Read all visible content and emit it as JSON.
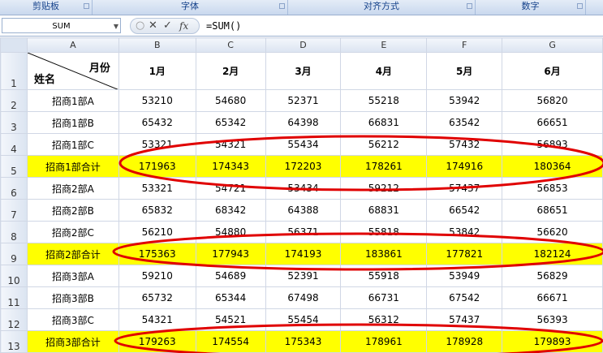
{
  "ribbon": {
    "groups": [
      "剪贴板",
      "字体",
      "对齐方式",
      "数字"
    ]
  },
  "formula_bar": {
    "name_box": "SUM",
    "fx_label": "fx",
    "formula": "=SUM()"
  },
  "sheet": {
    "columns": [
      "A",
      "B",
      "C",
      "D",
      "E",
      "F",
      "G"
    ],
    "header_month": "月份",
    "header_name": "姓名",
    "months": [
      "1月",
      "2月",
      "3月",
      "4月",
      "5月",
      "6月"
    ],
    "rows": [
      {
        "n": "2",
        "name": "招商1部A",
        "values": [
          "53210",
          "54680",
          "52371",
          "55218",
          "53942",
          "56820"
        ],
        "total": false
      },
      {
        "n": "3",
        "name": "招商1部B",
        "values": [
          "65432",
          "65342",
          "64398",
          "66831",
          "63542",
          "66651"
        ],
        "total": false
      },
      {
        "n": "4",
        "name": "招商1部C",
        "values": [
          "53321",
          "54321",
          "55434",
          "56212",
          "57432",
          "56893"
        ],
        "total": false
      },
      {
        "n": "5",
        "name": "招商1部合计",
        "values": [
          "171963",
          "174343",
          "172203",
          "178261",
          "174916",
          "180364"
        ],
        "total": true
      },
      {
        "n": "6",
        "name": "招商2部A",
        "values": [
          "53321",
          "54721",
          "53434",
          "59212",
          "57437",
          "56853"
        ],
        "total": false
      },
      {
        "n": "7",
        "name": "招商2部B",
        "values": [
          "65832",
          "68342",
          "64388",
          "68831",
          "66542",
          "68651"
        ],
        "total": false
      },
      {
        "n": "8",
        "name": "招商2部C",
        "values": [
          "56210",
          "54880",
          "56371",
          "55818",
          "53842",
          "56620"
        ],
        "total": false
      },
      {
        "n": "9",
        "name": "招商2部合计",
        "values": [
          "175363",
          "177943",
          "174193",
          "183861",
          "177821",
          "182124"
        ],
        "total": true
      },
      {
        "n": "10",
        "name": "招商3部A",
        "values": [
          "59210",
          "54689",
          "52391",
          "55918",
          "53949",
          "56829"
        ],
        "total": false
      },
      {
        "n": "11",
        "name": "招商3部B",
        "values": [
          "65732",
          "65344",
          "67498",
          "66731",
          "67542",
          "66671"
        ],
        "total": false
      },
      {
        "n": "12",
        "name": "招商3部C",
        "values": [
          "54321",
          "54521",
          "55454",
          "56312",
          "57437",
          "56393"
        ],
        "total": false
      },
      {
        "n": "13",
        "name": "招商3部合计",
        "values": [
          "179263",
          "174554",
          "175343",
          "178961",
          "178928",
          "179893"
        ],
        "total": true
      }
    ],
    "header_row_number": "1",
    "highlight_color": "#ffff00",
    "annotation_color": "#e00000"
  }
}
